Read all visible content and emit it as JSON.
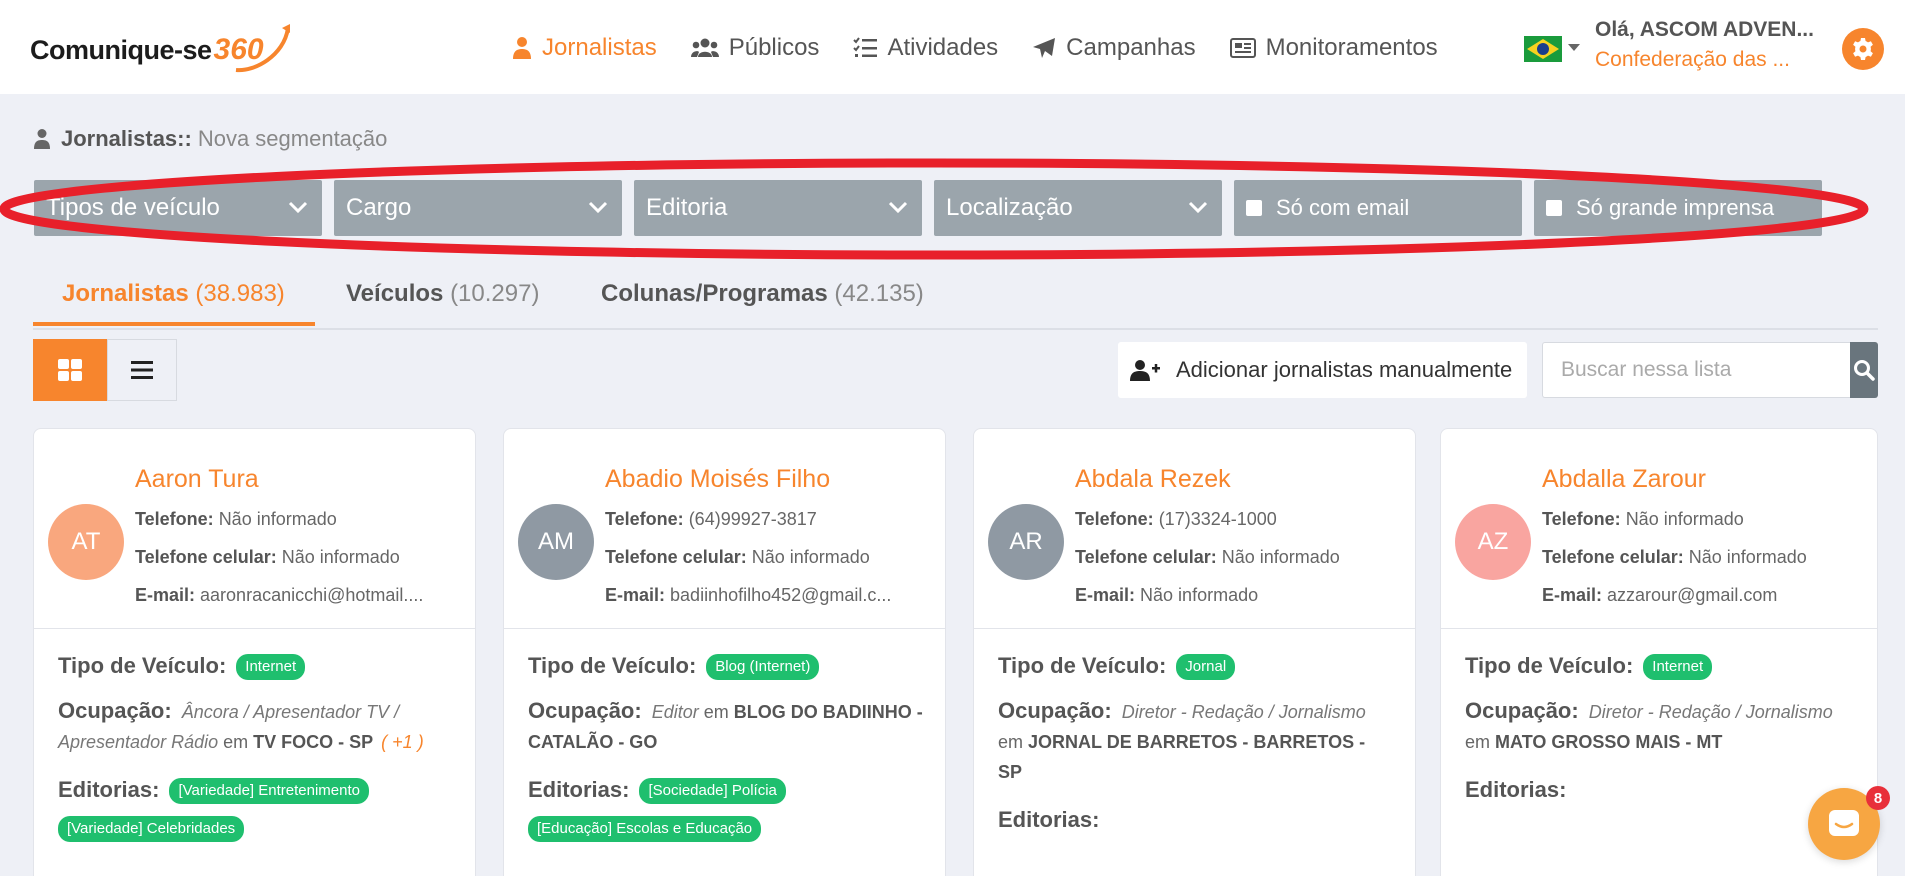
{
  "brand": {
    "logo_text": "Comunique-se",
    "logo_num": "360"
  },
  "nav": {
    "items": [
      {
        "label": "Jornalistas",
        "icon": "journalist-icon",
        "active": true
      },
      {
        "label": "Públicos",
        "icon": "users-icon",
        "active": false
      },
      {
        "label": "Atividades",
        "icon": "checklist-icon",
        "active": false
      },
      {
        "label": "Campanhas",
        "icon": "paper-plane-icon",
        "active": false
      },
      {
        "label": "Monitoramentos",
        "icon": "newspaper-icon",
        "active": false
      }
    ],
    "language_flag": "brazil-flag-icon",
    "user_greeting": "Olá, ASCOM ADVEN...",
    "user_org": "Confederação das ..."
  },
  "breadcrumb": {
    "section": "Jornalistas",
    "separator": "::",
    "page": "Nova segmentação"
  },
  "filters": {
    "vehicle_types": "Tipos de veículo",
    "role": "Cargo",
    "editorial": "Editoria",
    "location": "Localização",
    "only_email": "Só com email",
    "only_big_press": "Só grande imprensa"
  },
  "tabs": [
    {
      "label": "Jornalistas",
      "count": "(38.983)",
      "active": true
    },
    {
      "label": "Veículos",
      "count": "(10.297)",
      "active": false
    },
    {
      "label": "Colunas/Programas",
      "count": "(42.135)",
      "active": false
    }
  ],
  "toolbar": {
    "add_manual_label": "Adicionar jornalistas manualmente",
    "search_placeholder": "Buscar nessa lista"
  },
  "labels": {
    "phone": "Telefone:",
    "mobile": "Telefone celular:",
    "email": "E-mail:",
    "vehicle_type": "Tipo de Veículo:",
    "occupation": "Ocupação:",
    "editorials": "Editorias:",
    "at": "em"
  },
  "cards": [
    {
      "initials": "AT",
      "avatar_color": "#f9a77e",
      "name": "Aaron Tura",
      "phone": "Não informado",
      "mobile": "Não informado",
      "email": "aaronracanicchi@hotmail....",
      "vehicle_type": "Internet",
      "occupation_role": "Âncora / Apresentador TV / Apresentador Rádio",
      "occupation_vehicle": "TV FOCO - SP",
      "occupation_extra": "( +1 )",
      "editorials": [
        "[Variedade] Entretenimento",
        "[Variedade] Celebridades"
      ]
    },
    {
      "initials": "AM",
      "avatar_color": "#8f99a3",
      "name": "Abadio Moisés Filho",
      "phone": "(64)99927-3817",
      "mobile": "Não informado",
      "email": "badiinhofilho452@gmail.c...",
      "vehicle_type": "Blog (Internet)",
      "occupation_role": "Editor",
      "occupation_vehicle": "BLOG DO BADIINHO - CATALÃO - GO",
      "occupation_extra": "",
      "editorials": [
        "[Sociedade] Polícia",
        "[Educação] Escolas e Educação"
      ]
    },
    {
      "initials": "AR",
      "avatar_color": "#8f99a3",
      "name": "Abdala Rezek",
      "phone": "(17)3324-1000",
      "mobile": "Não informado",
      "email": "Não informado",
      "vehicle_type": "Jornal",
      "occupation_role": "Diretor - Redação / Jornalismo",
      "occupation_vehicle": "JORNAL DE BARRETOS - BARRETOS - SP",
      "occupation_extra": "",
      "editorials": []
    },
    {
      "initials": "AZ",
      "avatar_color": "#f9a5a0",
      "name": "Abdalla Zarour",
      "phone": "Não informado",
      "mobile": "Não informado",
      "email": "azzarour@gmail.com",
      "vehicle_type": "Internet",
      "occupation_role": "Diretor - Redação / Jornalismo",
      "occupation_vehicle": "MATO GROSSO MAIS - MT",
      "occupation_extra": "",
      "editorials": []
    }
  ],
  "chat": {
    "unread_count": "8"
  },
  "colors": {
    "accent": "#f7852d",
    "filter_bg": "#9ba5ac",
    "badge_green": "#1fbf6e",
    "annotation_red": "#e8202a"
  }
}
